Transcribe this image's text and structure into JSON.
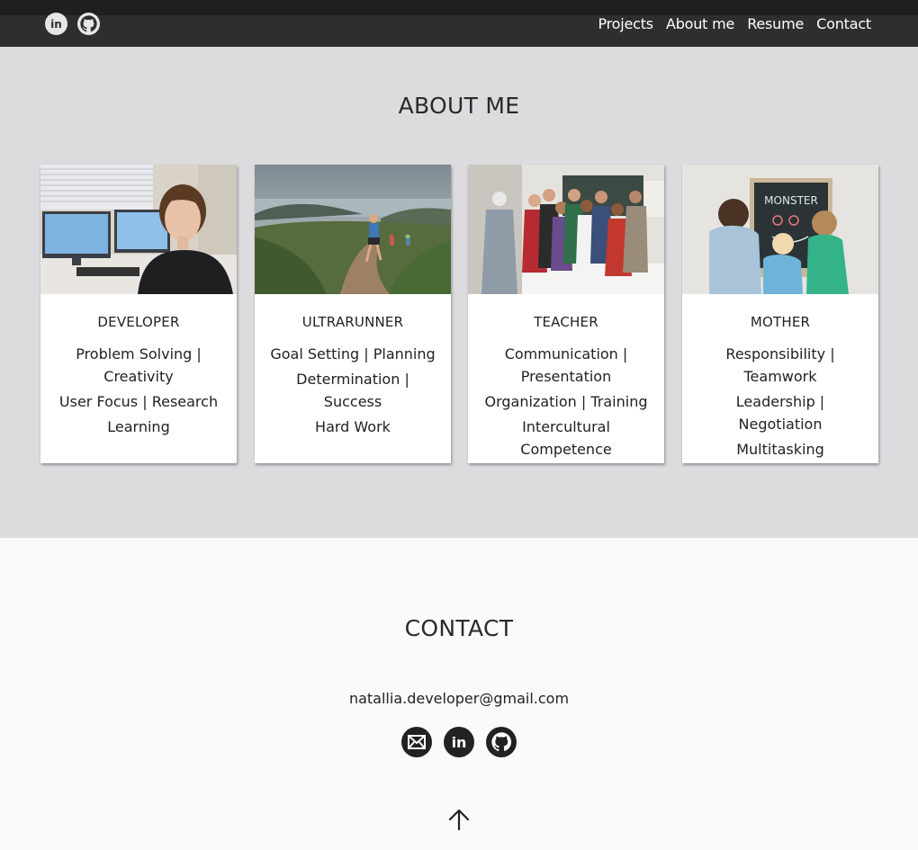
{
  "nav": {
    "icons": [
      "linkedin-icon",
      "github-icon"
    ],
    "links": [
      "Projects",
      "About me",
      "Resume",
      "Contact"
    ]
  },
  "about": {
    "title": "ABOUT ME",
    "cards": [
      {
        "title": "DEVELOPER",
        "skills": [
          "Problem Solving | Creativity",
          "User Focus | Research",
          "Learning"
        ]
      },
      {
        "title": "ULTRARUNNER",
        "skills": [
          "Goal Setting | Planning",
          "Determination | Success",
          "Hard Work"
        ]
      },
      {
        "title": "TEACHER",
        "skills": [
          "Communication | Presentation",
          "Organization | Training",
          "Intercultural Competence"
        ]
      },
      {
        "title": "MOTHER",
        "skills": [
          "Responsibility | Teamwork",
          "Leadership | Negotiation",
          "Multitasking"
        ]
      }
    ]
  },
  "contact": {
    "title": "CONTACT",
    "email": "natallia.developer@gmail.com",
    "icons": [
      "email-icon",
      "linkedin-icon",
      "github-icon"
    ],
    "back_to_top_icon": "arrow-up-icon"
  },
  "colors": {
    "nav_bg": "#2e2e2e",
    "about_bg": "#dcdcdf",
    "contact_bg": "#fafafa",
    "icon_dark": "#222222"
  }
}
